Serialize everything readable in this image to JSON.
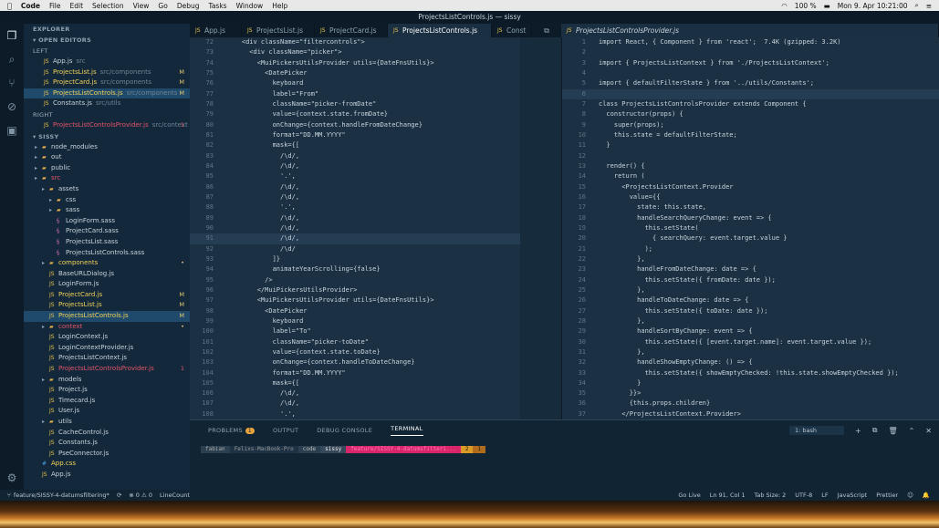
{
  "menubar": {
    "app": "Code",
    "items": [
      "File",
      "Edit",
      "Selection",
      "View",
      "Go",
      "Debug",
      "Tasks",
      "Window",
      "Help"
    ],
    "battery": "100 %",
    "clock": "Mon 9. Apr  10:21:00"
  },
  "window_title": "ProjectsListControls.js — sissy",
  "explorer": {
    "title": "EXPLORER",
    "open_editors": "OPEN EDITORS",
    "group_left": "LEFT",
    "group_right": "RIGHT",
    "project": "SISSY",
    "open_left": [
      {
        "name": "App.js",
        "desc": "src",
        "flag": "",
        "cls": "t-plain"
      },
      {
        "name": "ProjectsList.js",
        "desc": "src/components",
        "flag": "M",
        "cls": "t-yellow"
      },
      {
        "name": "ProjectCard.js",
        "desc": "src/components",
        "flag": "M",
        "cls": "t-yellow"
      },
      {
        "name": "ProjectsListControls.js",
        "desc": "src/components",
        "flag": "M",
        "cls": "t-yellow"
      },
      {
        "name": "Constants.js",
        "desc": "src/utils",
        "flag": "",
        "cls": "t-plain"
      }
    ],
    "open_right": [
      {
        "name": "ProjectsListControlsProvider.js",
        "desc": "src/context",
        "flag": "1",
        "cls": "t-red"
      }
    ],
    "tree": [
      {
        "name": "node_modules",
        "kind": "folder",
        "depth": 1,
        "cls": "t-plain",
        "flag": ""
      },
      {
        "name": "out",
        "kind": "folder",
        "depth": 1,
        "cls": "t-plain",
        "flag": ""
      },
      {
        "name": "public",
        "kind": "folder",
        "depth": 1,
        "cls": "t-plain",
        "flag": ""
      },
      {
        "name": "src",
        "kind": "folder",
        "depth": 1,
        "cls": "t-red",
        "flag": ""
      },
      {
        "name": "assets",
        "kind": "folder",
        "depth": 2,
        "cls": "t-plain",
        "flag": ""
      },
      {
        "name": "css",
        "kind": "folder",
        "depth": 3,
        "cls": "t-plain",
        "flag": ""
      },
      {
        "name": "sass",
        "kind": "folder",
        "depth": 3,
        "cls": "t-plain",
        "flag": ""
      },
      {
        "name": "LoginForm.sass",
        "kind": "sass",
        "depth": 4,
        "cls": "t-plain",
        "flag": ""
      },
      {
        "name": "ProjectCard.sass",
        "kind": "sass",
        "depth": 4,
        "cls": "t-plain",
        "flag": ""
      },
      {
        "name": "ProjectsList.sass",
        "kind": "sass",
        "depth": 4,
        "cls": "t-plain",
        "flag": ""
      },
      {
        "name": "ProjectsListControls.sass",
        "kind": "sass",
        "depth": 4,
        "cls": "t-plain",
        "flag": ""
      },
      {
        "name": "components",
        "kind": "folder",
        "depth": 2,
        "cls": "t-yellow",
        "flag": "•"
      },
      {
        "name": "BaseURLDialog.js",
        "kind": "js",
        "depth": 3,
        "cls": "t-plain",
        "flag": ""
      },
      {
        "name": "LoginForm.js",
        "kind": "js",
        "depth": 3,
        "cls": "t-plain",
        "flag": ""
      },
      {
        "name": "ProjectCard.js",
        "kind": "js",
        "depth": 3,
        "cls": "t-yellow",
        "flag": "M"
      },
      {
        "name": "ProjectsList.js",
        "kind": "js",
        "depth": 3,
        "cls": "t-yellow",
        "flag": "M"
      },
      {
        "name": "ProjectsListControls.js",
        "kind": "js",
        "depth": 3,
        "cls": "t-yellow",
        "flag": "M"
      },
      {
        "name": "context",
        "kind": "folder",
        "depth": 2,
        "cls": "t-red",
        "flag": "•"
      },
      {
        "name": "LoginContext.js",
        "kind": "js",
        "depth": 3,
        "cls": "t-plain",
        "flag": ""
      },
      {
        "name": "LoginContextProvider.js",
        "kind": "js",
        "depth": 3,
        "cls": "t-plain",
        "flag": ""
      },
      {
        "name": "ProjectsListContext.js",
        "kind": "js",
        "depth": 3,
        "cls": "t-plain",
        "flag": ""
      },
      {
        "name": "ProjectsListControlsProvider.js",
        "kind": "js",
        "depth": 3,
        "cls": "t-red",
        "flag": "1"
      },
      {
        "name": "models",
        "kind": "folder",
        "depth": 2,
        "cls": "t-plain",
        "flag": ""
      },
      {
        "name": "Project.js",
        "kind": "js",
        "depth": 3,
        "cls": "t-plain",
        "flag": ""
      },
      {
        "name": "Timecard.js",
        "kind": "js",
        "depth": 3,
        "cls": "t-plain",
        "flag": ""
      },
      {
        "name": "User.js",
        "kind": "js",
        "depth": 3,
        "cls": "t-plain",
        "flag": ""
      },
      {
        "name": "utils",
        "kind": "folder",
        "depth": 2,
        "cls": "t-plain",
        "flag": ""
      },
      {
        "name": "CacheControl.js",
        "kind": "js",
        "depth": 3,
        "cls": "t-plain",
        "flag": ""
      },
      {
        "name": "Constants.js",
        "kind": "js",
        "depth": 3,
        "cls": "t-plain",
        "flag": ""
      },
      {
        "name": "PseConnector.js",
        "kind": "js",
        "depth": 3,
        "cls": "t-plain",
        "flag": ""
      },
      {
        "name": "App.css",
        "kind": "css",
        "depth": 2,
        "cls": "t-yellow",
        "flag": ""
      },
      {
        "name": "App.js",
        "kind": "js",
        "depth": 2,
        "cls": "t-plain",
        "flag": ""
      }
    ]
  },
  "tabs_left": [
    "App.js",
    "ProjectsList.js",
    "ProjectCard.js",
    "ProjectsListControls.js",
    "Const"
  ],
  "tab_right": "ProjectsListControlsProvider.js",
  "editor_left": {
    "start": 72,
    "lines": [
      "    <div className=\"filtercontrols\">",
      "      <div className=\"picker\">",
      "        <MuiPickersUtilsProvider utils={DateFnsUtils}>",
      "          <DatePicker",
      "            keyboard",
      "            label=\"From\"",
      "            className=\"picker-fromDate\"",
      "            value={context.state.fromDate}",
      "            onChange={context.handleFromDateChange}",
      "            format=\"DD.MM.YYYY\"",
      "            mask={[",
      "              /\\d/,",
      "              /\\d/,",
      "              '.',",
      "              /\\d/,",
      "              /\\d/,",
      "              '.',",
      "              /\\d/,",
      "              /\\d/,",
      "              /\\d/,",
      "              /\\d/",
      "            ]}",
      "            animateYearScrolling={false}",
      "          />",
      "        </MuiPickersUtilsProvider>",
      "        <MuiPickersUtilsProvider utils={DateFnsUtils}>",
      "          <DatePicker",
      "            keyboard",
      "            label=\"To\"",
      "            className=\"picker-toDate\"",
      "            value={context.state.toDate}",
      "            onChange={context.handleToDateChange}",
      "            format=\"DD.MM.YYYY\"",
      "            mask={[",
      "              /\\d/,",
      "              /\\d/,",
      "              '.',"
    ]
  },
  "editor_right": {
    "start": 1,
    "lines": [
      "import React, { Component } from 'react';  7.4K (gzipped: 3.2K)",
      "",
      "import { ProjectsListContext } from './ProjectsListContext';",
      "",
      "import { defaultFilterState } from '../utils/Constants';",
      "",
      "class ProjectsListControlsProvider extends Component {",
      "  constructor(props) {",
      "    super(props);",
      "    this.state = defaultFilterState;",
      "  }",
      "",
      "  render() {",
      "    return (",
      "      <ProjectsListContext.Provider",
      "        value={{",
      "          state: this.state,",
      "          handleSearchQueryChange: event => {",
      "            this.setState(",
      "              { searchQuery: event.target.value }",
      "            );",
      "          },",
      "          handleFromDateChange: date => {",
      "            this.setState({ fromDate: date });",
      "          },",
      "          handleToDateChange: date => {",
      "            this.setState({ toDate: date });",
      "          },",
      "          handleSortByChange: event => {",
      "            this.setState({ [event.target.name]: event.target.value });",
      "          },",
      "          handleShowEmptyChange: () => {",
      "            this.setState({ showEmptyChecked: !this.state.showEmptyChecked });",
      "          }",
      "        }}>",
      "        {this.props.children}",
      "      </ProjectsListContext.Provider>"
    ]
  },
  "panel": {
    "tabs": [
      "PROBLEMS",
      "OUTPUT",
      "DEBUG CONSOLE",
      "TERMINAL"
    ],
    "problems_count": "1",
    "shell": "1: bash",
    "prompt": [
      "fabian",
      "Felixs-MacBook-Pro",
      "code",
      "sissy",
      "feature/SISSY-4-datumsfilteri...",
      "2",
      "1"
    ]
  },
  "status": {
    "branch": "feature/SISSY-4-datumsfiltering*",
    "errors": "⊗ 0 ⚠ 0",
    "linecount": "LineCount",
    "golive": "Go Live",
    "position": "Ln 91, Col 1",
    "tabsize": "Tab Size: 2",
    "encoding": "UTF-8",
    "eol": "LF",
    "language": "JavaScript",
    "formatter": "Prettier"
  },
  "colors": {
    "accent": "#e5546a",
    "modified": "#e6c870",
    "bg": "#1b3143"
  }
}
